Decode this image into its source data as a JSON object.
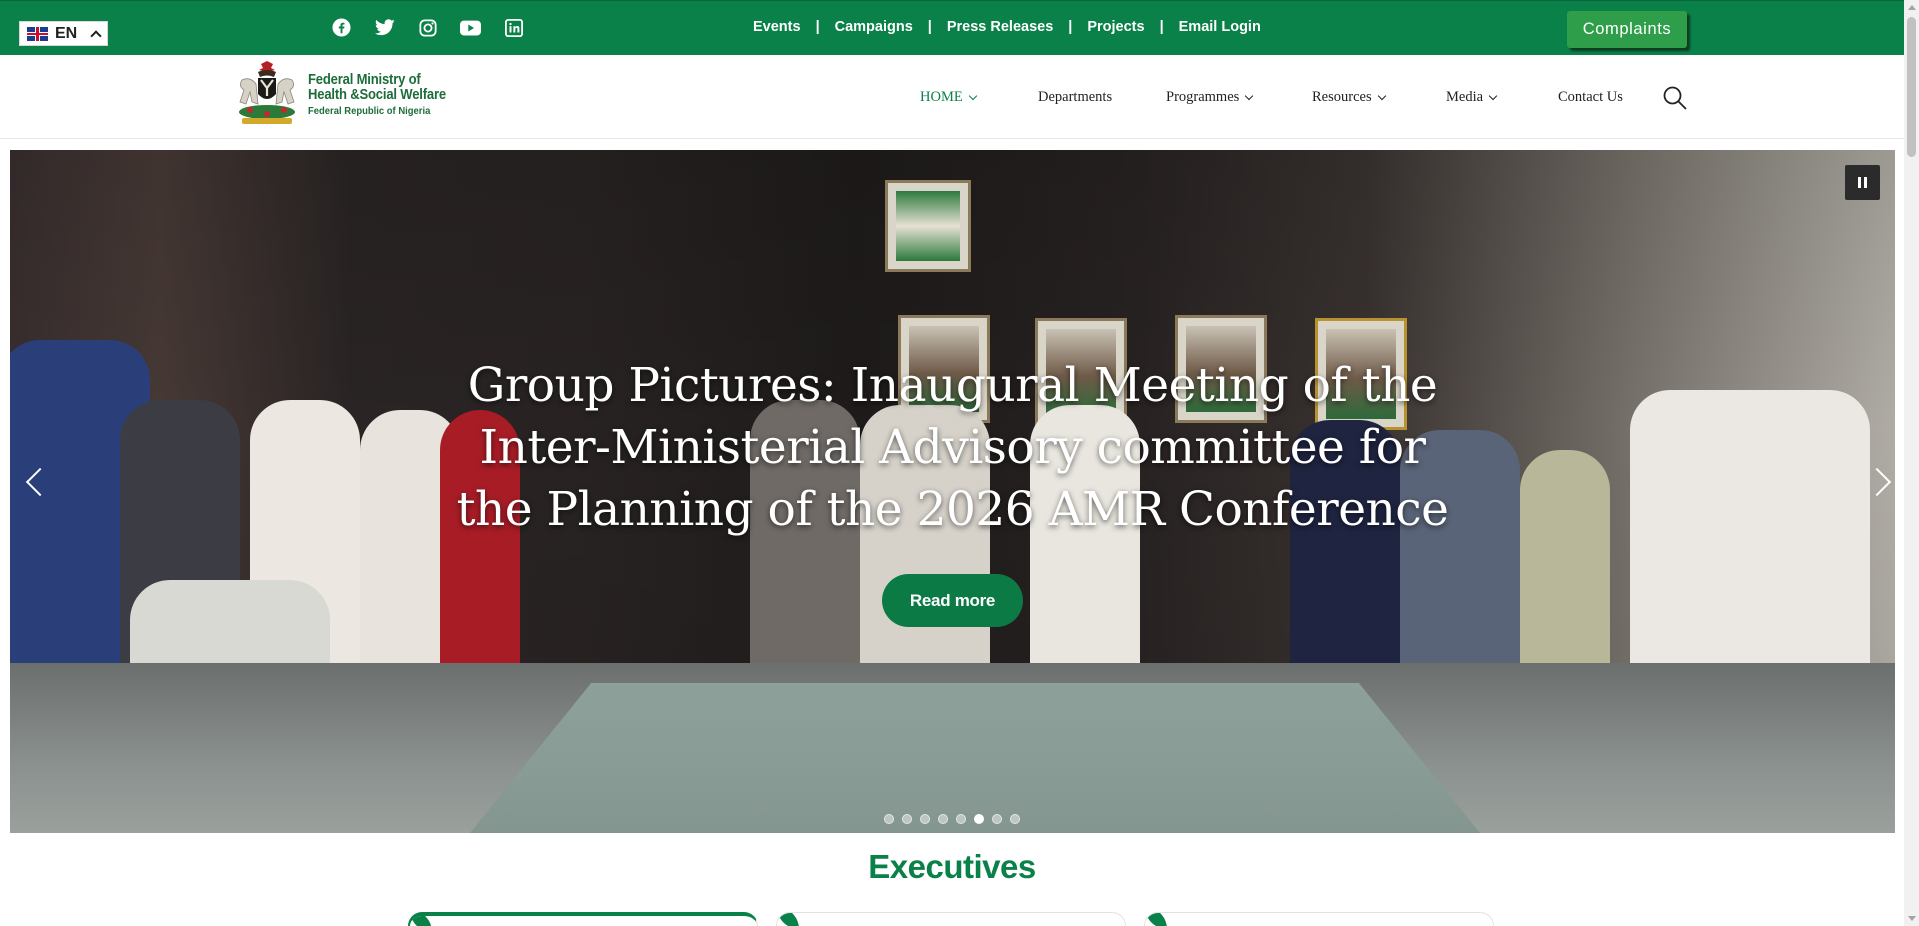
{
  "topbar": {
    "language": {
      "code": "EN",
      "flag": "uk-flag-icon"
    },
    "social": [
      {
        "name": "facebook-icon"
      },
      {
        "name": "twitter-icon"
      },
      {
        "name": "instagram-icon"
      },
      {
        "name": "youtube-icon"
      },
      {
        "name": "linkedin-icon"
      }
    ],
    "links": [
      "Events",
      "Campaigns",
      "Press Releases",
      "Projects",
      "Email Login"
    ],
    "separator": "|",
    "complaints_label": "Complaints"
  },
  "header": {
    "logo": {
      "line1": "Federal Ministry of",
      "line2": "Health &Social Welfare",
      "line3": "Federal Republic of Nigeria"
    },
    "nav": [
      {
        "label": "HOME",
        "has_dropdown": true,
        "active": true
      },
      {
        "label": "Departments",
        "has_dropdown": false,
        "active": false
      },
      {
        "label": "Programmes",
        "has_dropdown": true,
        "active": false
      },
      {
        "label": "Resources",
        "has_dropdown": true,
        "active": false
      },
      {
        "label": "Media",
        "has_dropdown": true,
        "active": false
      },
      {
        "label": "Contact Us",
        "has_dropdown": false,
        "active": false
      }
    ],
    "search_icon": "search-icon"
  },
  "hero": {
    "title_lines": [
      "Group Pictures: Inaugural Meeting of the",
      "Inter-Ministerial Advisory committee for",
      "the Planning of the 2026 AMR Conference"
    ],
    "button_label": "Read more",
    "slide_count": 8,
    "active_slide": 6
  },
  "executives": {
    "title": "Executives"
  },
  "colors": {
    "brand_green": "#0a8148",
    "complaints_green": "#2e9e4b",
    "button_green": "#0b7a44"
  }
}
